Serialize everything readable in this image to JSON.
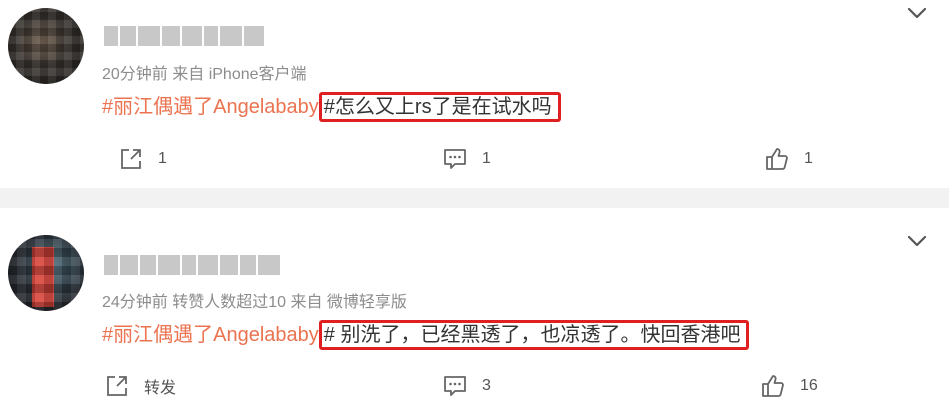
{
  "posts": [
    {
      "meta": "20分钟前  来自 iPhone客户端",
      "hashtag": "#丽江偶遇了Angelababy",
      "text": "#怎么又上rs了是在试水吗",
      "repost": "1",
      "comments": "1",
      "likes": "1"
    },
    {
      "meta": "24分钟前 转赞人数超过10  来自 微博轻享版",
      "hashtag": "#丽江偶遇了Angelababy",
      "text": "# 别洗了，已经黑透了，也凉透了。快回香港吧",
      "repost": "转发",
      "comments": "3",
      "likes": "16"
    }
  ],
  "icons": {
    "chevron": "chevron-down-icon",
    "repost": "repost-icon",
    "comment": "comment-icon",
    "like": "like-icon"
  },
  "colors": {
    "hashtag": "#eb7350",
    "highlight_box": "#e02020",
    "meta_text": "#8c8c8c",
    "divider": "#f2f2f2"
  }
}
